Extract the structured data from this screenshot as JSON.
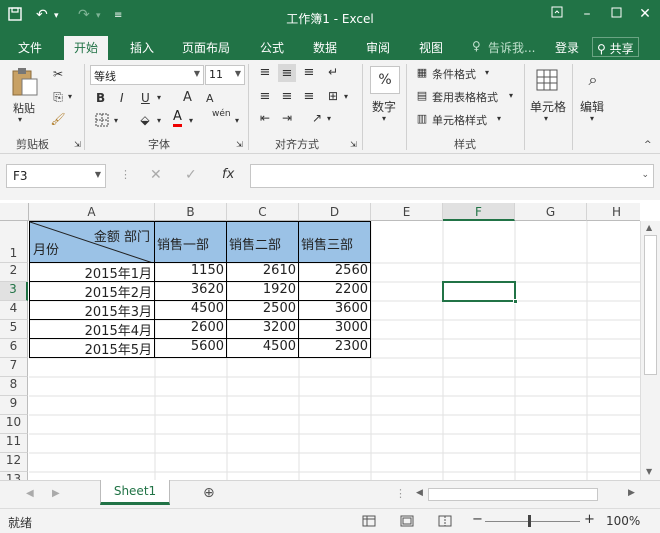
{
  "window": {
    "title": "工作簿1 - Excel"
  },
  "tabs": [
    "文件",
    "开始",
    "插入",
    "页面布局",
    "公式",
    "数据",
    "审阅",
    "视图"
  ],
  "tell_me": "告诉我...",
  "login": "登录",
  "share": "共享",
  "ribbon": {
    "paste": "粘贴",
    "font_name": "等线",
    "font_size": "11",
    "groups": {
      "clipboard": "剪贴板",
      "font": "字体",
      "align": "对齐方式",
      "styles": "样式"
    },
    "bold": "B",
    "italic": "I",
    "underline": "U",
    "grow_font": "A",
    "shrink_font": "A",
    "font_color": "A",
    "wen": "wén",
    "cond_format": "条件格式",
    "table_format": "套用表格格式",
    "cell_style": "单元格样式",
    "number": "数字",
    "percent": "%",
    "cells": "单元格",
    "edit": "编辑"
  },
  "formula_bar": {
    "name_box": "F3",
    "fx": "fx",
    "value": ""
  },
  "columns": [
    "A",
    "B",
    "C",
    "D",
    "E",
    "F",
    "G",
    "H"
  ],
  "rows": [
    "1",
    "2",
    "3",
    "4",
    "5",
    "6",
    "7",
    "8",
    "9",
    "10",
    "11",
    "12",
    "13"
  ],
  "table": {
    "header_corner_top": "金额  部门",
    "header_corner_bottom": "月份",
    "headers": [
      "销售一部",
      "销售二部",
      "销售三部"
    ],
    "data": [
      [
        "2015年1月",
        "1150",
        "2610",
        "2560"
      ],
      [
        "2015年2月",
        "3620",
        "1920",
        "2200"
      ],
      [
        "2015年3月",
        "4500",
        "2500",
        "3600"
      ],
      [
        "2015年4月",
        "2600",
        "3200",
        "3000"
      ],
      [
        "2015年5月",
        "5600",
        "4500",
        "2300"
      ]
    ]
  },
  "sheet": {
    "name": "Sheet1"
  },
  "status": {
    "ready": "就绪",
    "zoom": "100%",
    "plus": "+",
    "minus": "−"
  }
}
